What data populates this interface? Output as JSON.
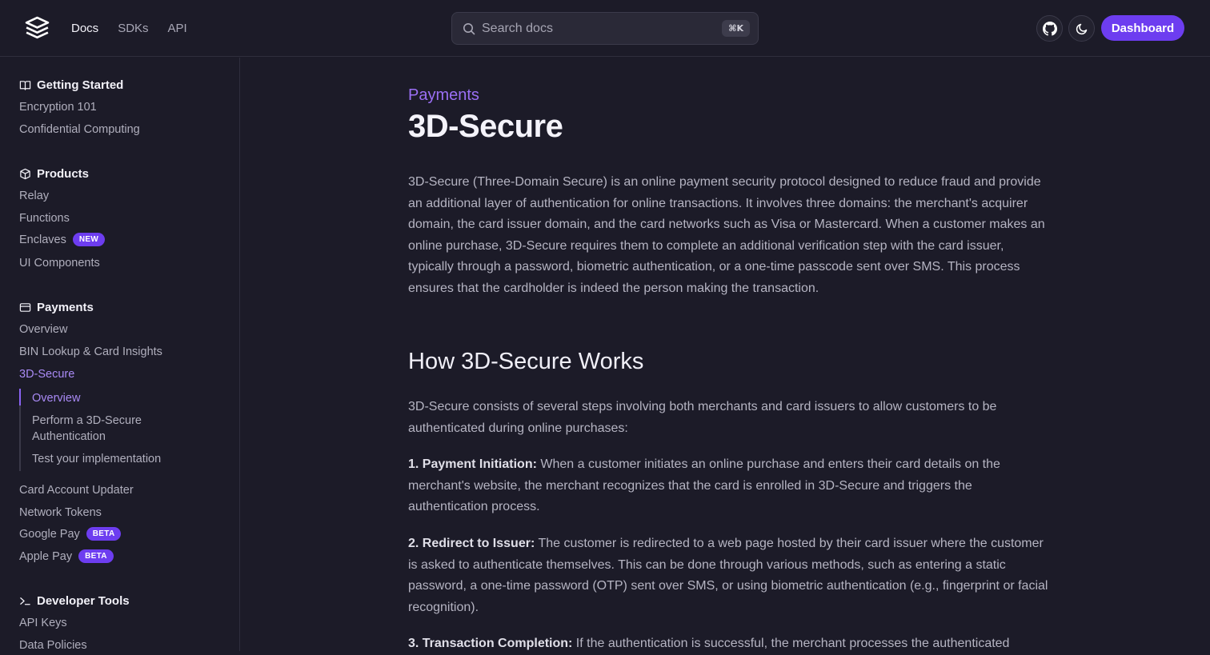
{
  "header": {
    "nav": [
      "Docs",
      "SDKs",
      "API"
    ],
    "search_placeholder": "Search docs",
    "search_shortcut": "⌘K",
    "dashboard_label": "Dashboard"
  },
  "sidebar": {
    "getting_started": {
      "title": "Getting Started",
      "items": [
        "Encryption 101",
        "Confidential Computing"
      ]
    },
    "products": {
      "title": "Products",
      "items": [
        "Relay",
        "Functions",
        "Enclaves",
        "UI Components"
      ],
      "enclaves_badge": "NEW"
    },
    "payments": {
      "title": "Payments",
      "items": [
        "Overview",
        "BIN Lookup & Card Insights",
        "3D-Secure"
      ],
      "sub_items": [
        "Overview",
        "Perform a 3D-Secure Authentication",
        "Test your implementation"
      ],
      "more_items": [
        "Card Account Updater",
        "Network Tokens",
        "Google Pay",
        "Apple Pay"
      ],
      "beta_badge": "BETA"
    },
    "developer_tools": {
      "title": "Developer Tools",
      "items": [
        "API Keys",
        "Data Policies"
      ]
    }
  },
  "main": {
    "eyebrow": "Payments",
    "title": "3D-Secure",
    "intro": "3D-Secure (Three-Domain Secure) is an online payment security protocol designed to reduce fraud and provide an additional layer of authentication for online transactions. It involves three domains: the merchant's acquirer domain, the card issuer domain, and the card networks such as Visa or Mastercard. When a customer makes an online purchase, 3D-Secure requires them to complete an additional verification step with the card issuer, typically through a password, biometric authentication, or a one-time passcode sent over SMS. This process ensures that the cardholder is indeed the person making the transaction.",
    "h2": "How 3D-Secure Works",
    "steps_intro": "3D-Secure consists of several steps involving both merchants and card issuers to allow customers to be authenticated during online purchases:",
    "steps": [
      {
        "label": "1. Payment Initiation:",
        "text": " When a customer initiates an online purchase and enters their card details on the merchant's website, the merchant recognizes that the card is enrolled in 3D-Secure and triggers the authentication process."
      },
      {
        "label": "2. Redirect to Issuer:",
        "text": " The customer is redirected to a web page hosted by their card issuer where the customer is asked to authenticate themselves. This can be done through various methods, such as entering a static password, a one-time password (OTP) sent over SMS, or using biometric authentication (e.g., fingerprint or facial recognition)."
      },
      {
        "label": "3. Transaction Completion:",
        "text": " If the authentication is successful, the merchant processes the authenticated"
      }
    ]
  },
  "colors": {
    "accent": "#6d3df0",
    "accent_text": "#a98af5",
    "background": "#1c1b28"
  },
  "icons": [
    "logo-icon",
    "search-icon",
    "github-icon",
    "moon-icon",
    "book-icon",
    "cube-icon",
    "card-icon",
    "terminal-icon"
  ]
}
